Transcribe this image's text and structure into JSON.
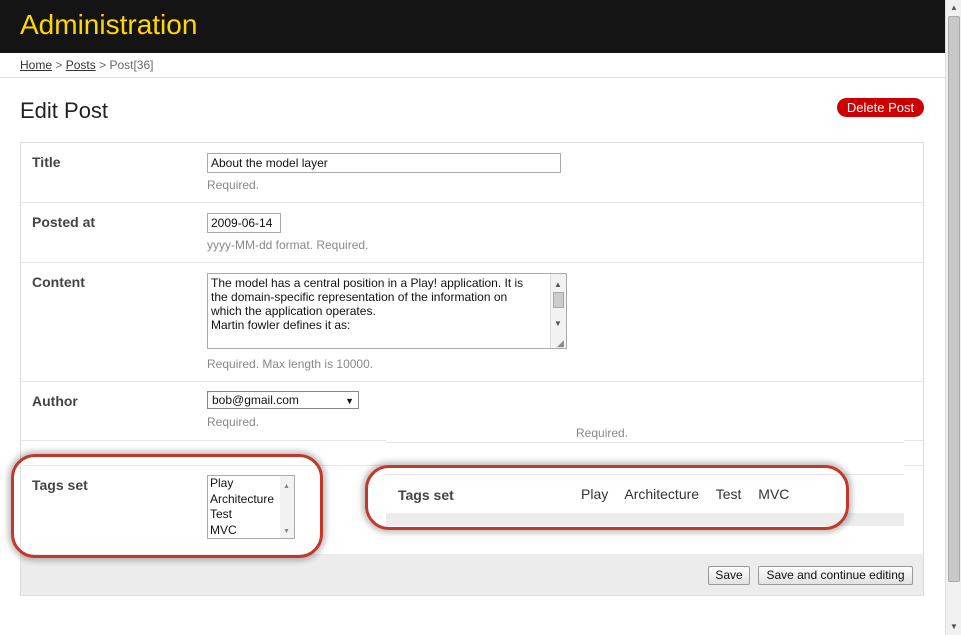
{
  "header": {
    "title": "Administration"
  },
  "breadcrumb": {
    "home": "Home",
    "posts": "Posts",
    "current": "Post[36]",
    "sep": ">"
  },
  "page": {
    "title": "Edit Post",
    "delete_label": "Delete Post"
  },
  "form": {
    "title": {
      "label": "Title",
      "value": "About the model layer",
      "help": "Required."
    },
    "posted_at": {
      "label": "Posted at",
      "value": "2009-06-14",
      "help": "yyyy-MM-dd format. Required."
    },
    "content": {
      "label": "Content",
      "lines": [
        "The model has a central position in a Play! application. It is",
        "the domain-specific  representation of the information on",
        "which the application operates.",
        "Martin fowler defines it as:"
      ],
      "help": "Required. Max length is 10000."
    },
    "author": {
      "label": "Author",
      "value": "bob@gmail.com",
      "help": "Required."
    },
    "tags": {
      "label": "Tags set",
      "options": [
        "Play",
        "Architecture",
        "Test",
        "MVC"
      ]
    }
  },
  "buttons": {
    "save": "Save",
    "save_continue": "Save and continue editing"
  },
  "panel": {
    "required_text": "Required.",
    "label": "Tags set",
    "tags": [
      "Play",
      "Architecture",
      "Test",
      "MVC"
    ]
  },
  "colors": {
    "header_bg": "#141414",
    "header_title": "#ffd700",
    "delete_btn": "#cc0000",
    "highlight": "#c0392b"
  }
}
